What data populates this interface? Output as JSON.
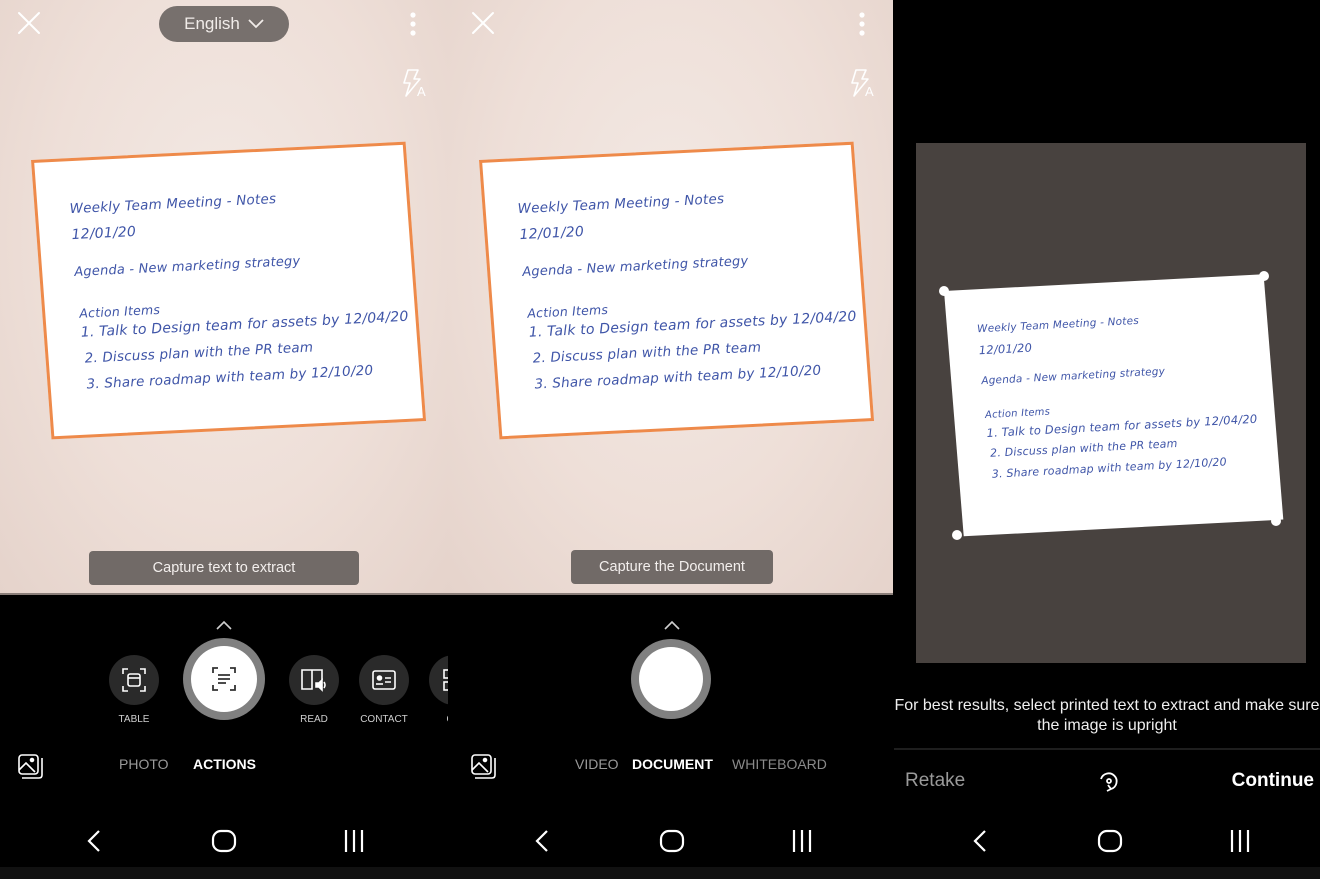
{
  "document": {
    "lines": [
      "Weekly Team Meeting - Notes",
      "12/01/20",
      "Agenda - New marketing strategy",
      "Action Items",
      "1. Talk to Design team for assets by 12/04/20",
      "2. Discuss plan with the PR team",
      "3. Share roadmap with team by 12/10/20"
    ]
  },
  "panel1": {
    "language": "English",
    "hint": "Capture text to extract",
    "actions": [
      {
        "label": "TABLE",
        "icon": "table-scan-icon"
      },
      {
        "label": "",
        "icon": "text-scan-icon",
        "selected": true
      },
      {
        "label": "READ",
        "icon": "read-aloud-icon"
      },
      {
        "label": "CONTACT",
        "icon": "contact-card-icon"
      },
      {
        "label": "QR",
        "icon": "qr-code-icon"
      }
    ],
    "modes": [
      {
        "label": "PHOTO",
        "active": false
      },
      {
        "label": "ACTIONS",
        "active": true
      }
    ]
  },
  "panel2": {
    "hint": "Capture the Document",
    "modes": [
      {
        "label": "VIDEO",
        "active": false
      },
      {
        "label": "DOCUMENT",
        "active": true
      },
      {
        "label": "WHITEBOARD",
        "active": false
      }
    ]
  },
  "panel3": {
    "tip": "For best results, select printed text to extract and make sure the image is upright",
    "retake": "Retake",
    "continue": "Continue"
  },
  "colors": {
    "accent_outline": "#ee8a4a",
    "ink": "#3f55a8"
  }
}
